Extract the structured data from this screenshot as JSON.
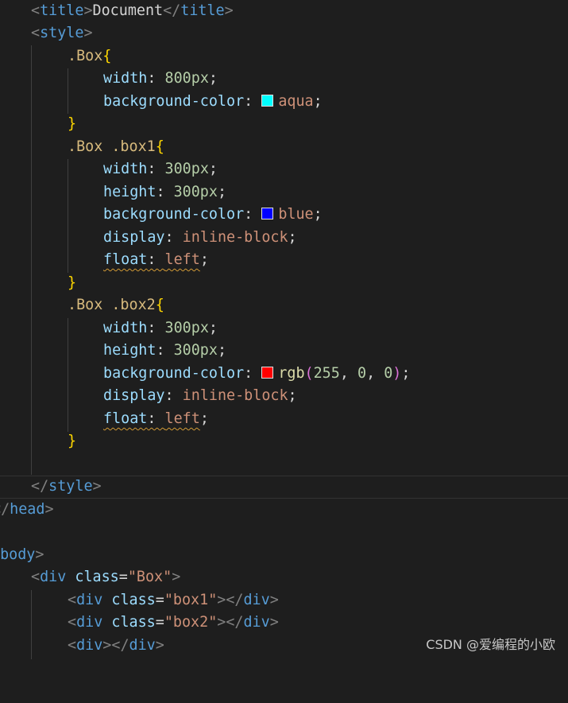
{
  "colors": {
    "aqua": "#00ffff",
    "blue": "#0000ff",
    "red": "#ff0000"
  },
  "code": {
    "title_line": {
      "tag_open": "title",
      "text": "Document",
      "tag_close": "title"
    },
    "style_open": "style",
    "rule1": {
      "selector": ".Box",
      "width_prop": "width",
      "width_val": "800px",
      "bg_prop": "background-color",
      "bg_val": "aqua"
    },
    "rule2": {
      "selector": ".Box .box1",
      "width_prop": "width",
      "width_val": "300px",
      "height_prop": "height",
      "height_val": "300px",
      "bg_prop": "background-color",
      "bg_val": "blue",
      "display_prop": "display",
      "display_val": "inline-block",
      "float_prop": "float",
      "float_val": "left"
    },
    "rule3": {
      "selector": ".Box .box2",
      "width_prop": "width",
      "width_val": "300px",
      "height_prop": "height",
      "height_val": "300px",
      "bg_prop": "background-color",
      "bg_fn": "rgb",
      "bg_r": "255",
      "bg_g": "0",
      "bg_b": "0",
      "display_prop": "display",
      "display_val": "inline-block",
      "float_prop": "float",
      "float_val": "left"
    },
    "style_close": "style",
    "head_close": "head",
    "body_open": "body",
    "div_box": {
      "tag": "div",
      "attr": "class",
      "value": "\"Box\""
    },
    "div_box1": {
      "tag": "div",
      "attr": "class",
      "value": "\"box1\""
    },
    "div_box2": {
      "tag": "div",
      "attr": "class",
      "value": "\"box2\""
    },
    "div_empty": {
      "tag": "div"
    }
  },
  "watermark": "CSDN @爱编程的小欧"
}
